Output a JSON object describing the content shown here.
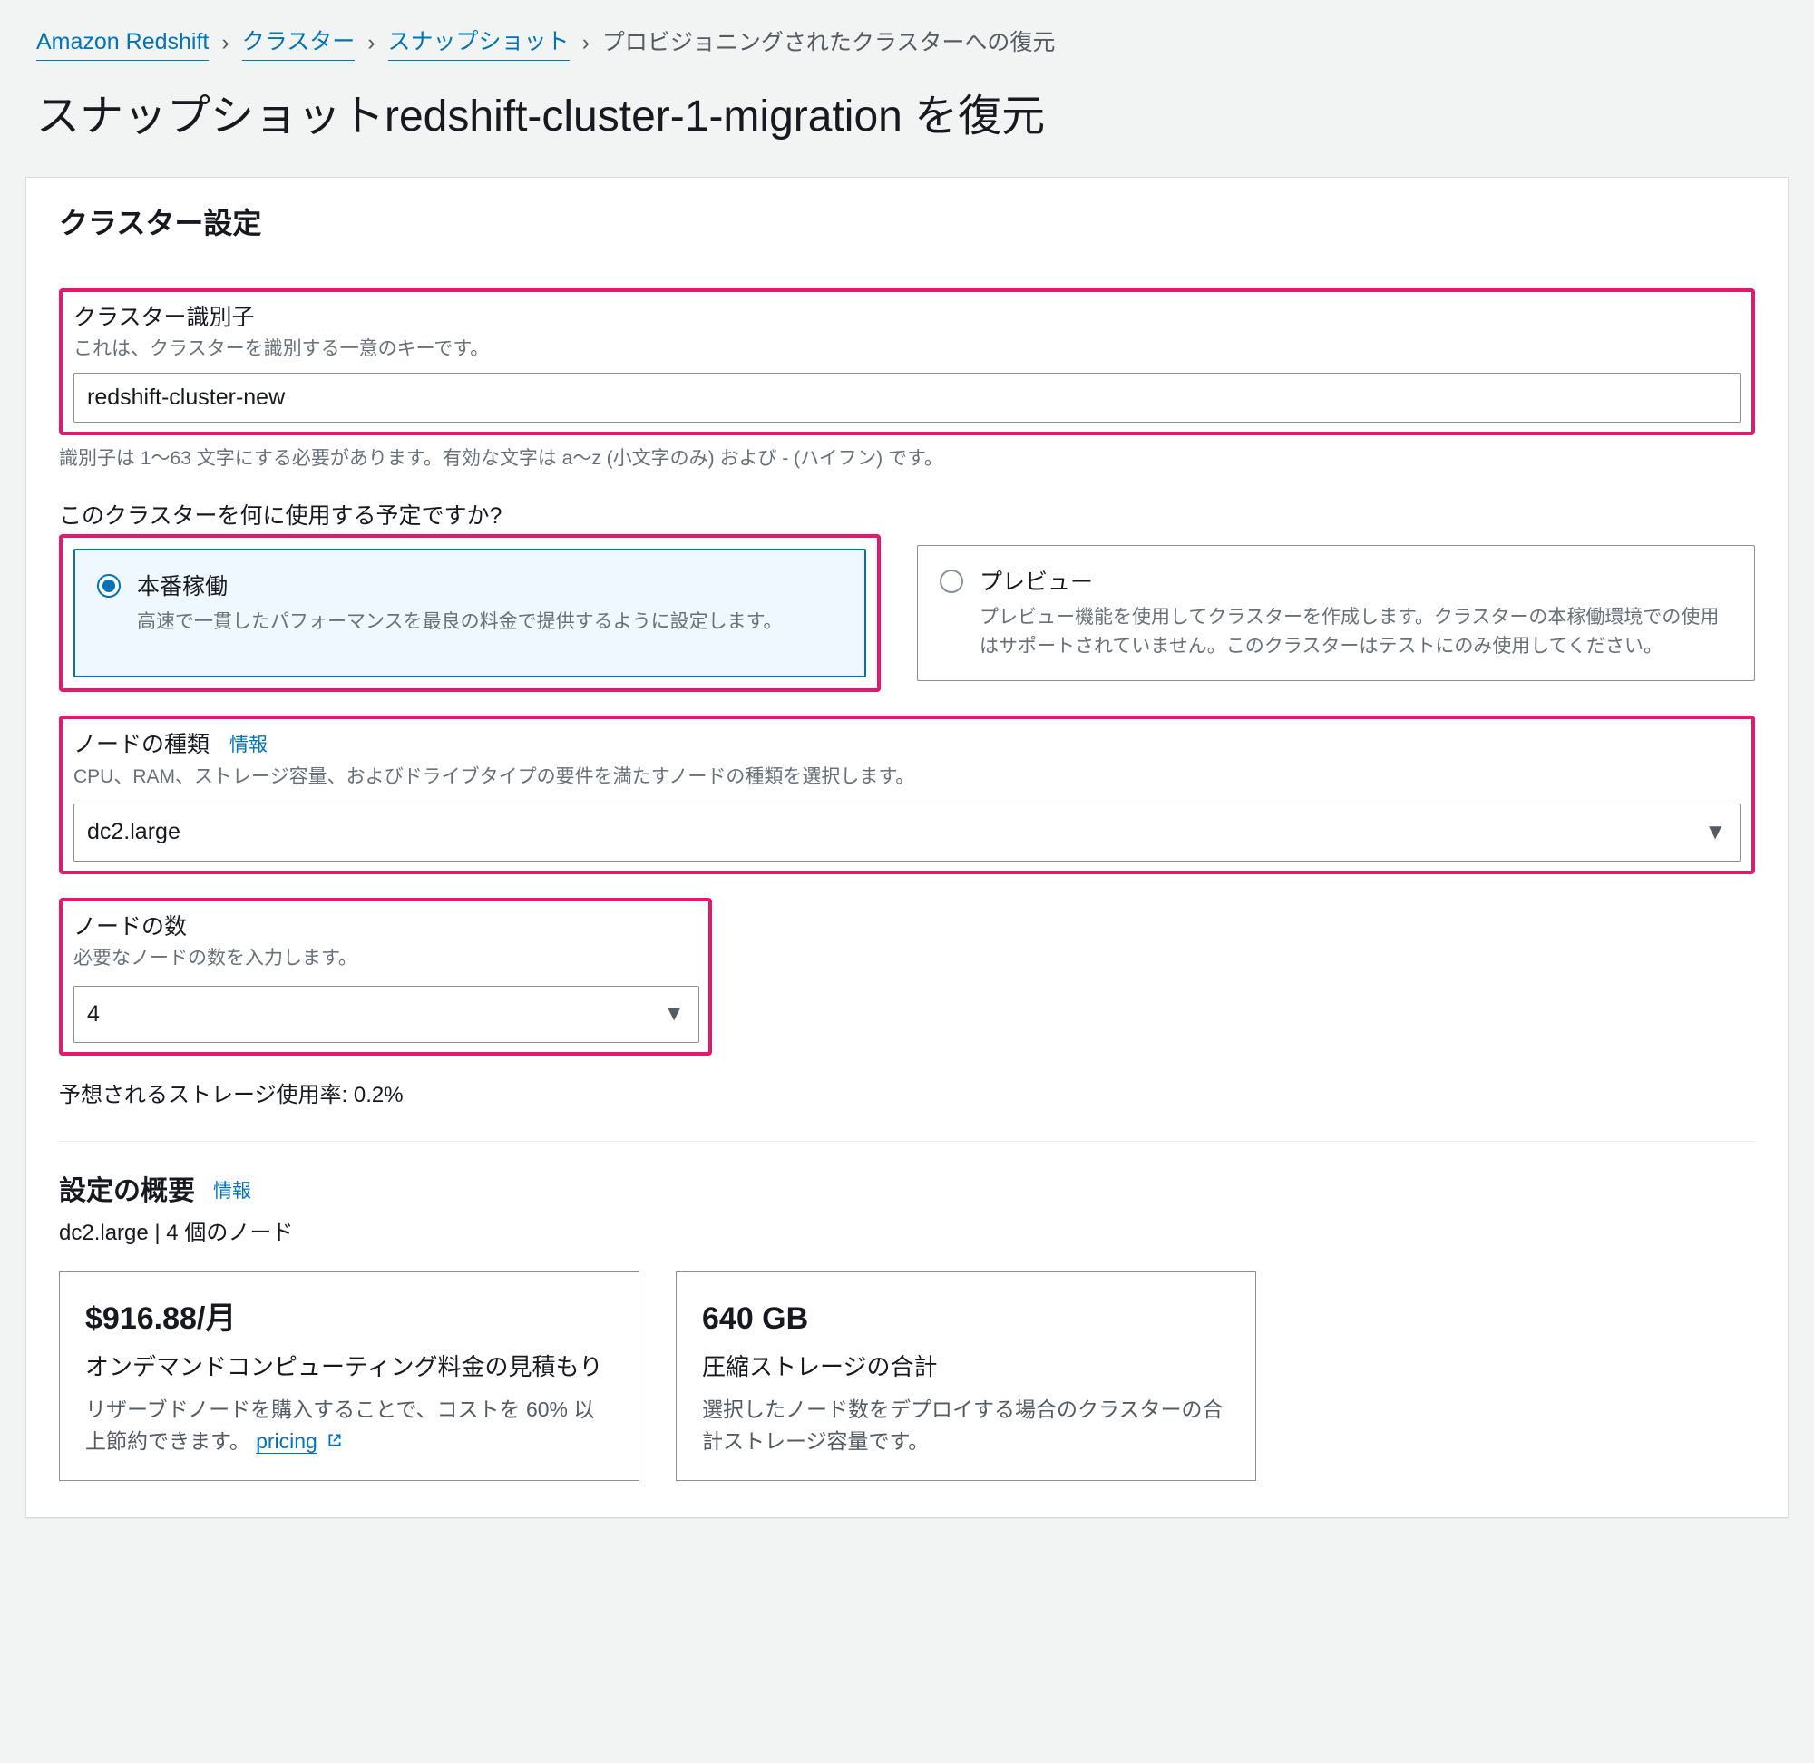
{
  "breadcrumb": {
    "items": [
      {
        "label": "Amazon Redshift"
      },
      {
        "label": "クラスター"
      },
      {
        "label": "スナップショット"
      }
    ],
    "current": "プロビジョニングされたクラスターへの復元"
  },
  "page_title": "スナップショットredshift-cluster-1-migration を復元",
  "panel": {
    "title": "クラスター設定",
    "cluster_id": {
      "label": "クラスター識別子",
      "description": "これは、クラスターを識別する一意のキーです。",
      "value": "redshift-cluster-new",
      "constraint": "識別子は 1〜63 文字にする必要があります。有効な文字は a〜z (小文字のみ) および - (ハイフン) です。"
    },
    "usage_question": "このクラスターを何に使用する予定ですか?",
    "usage_options": {
      "production": {
        "title": "本番稼働",
        "description": "高速で一貫したパフォーマンスを最良の料金で提供するように設定します。"
      },
      "preview": {
        "title": "プレビュー",
        "description": "プレビュー機能を使用してクラスターを作成します。クラスターの本稼働環境での使用はサポートされていません。このクラスターはテストにのみ使用してください。"
      }
    },
    "node_type": {
      "label": "ノードの種類",
      "info": "情報",
      "description": "CPU、RAM、ストレージ容量、およびドライブタイプの要件を満たすノードの種類を選択します。",
      "value": "dc2.large"
    },
    "node_count": {
      "label": "ノードの数",
      "description": "必要なノードの数を入力します。",
      "value": "4"
    },
    "predicted_storage": "予想されるストレージ使用率: 0.2%",
    "summary": {
      "title": "設定の概要",
      "info": "情報",
      "sub": "dc2.large | 4 個のノード",
      "pricing": {
        "big": "$916.88/月",
        "mid": "オンデマンドコンピューティング料金の見積もり",
        "small_prefix": "リザーブドノードを購入することで、コストを 60% 以上節約できます。 ",
        "link": "pricing"
      },
      "storage": {
        "big": "640 GB",
        "mid": "圧縮ストレージの合計",
        "small": "選択したノード数をデプロイする場合のクラスターの合計ストレージ容量です。"
      }
    }
  }
}
